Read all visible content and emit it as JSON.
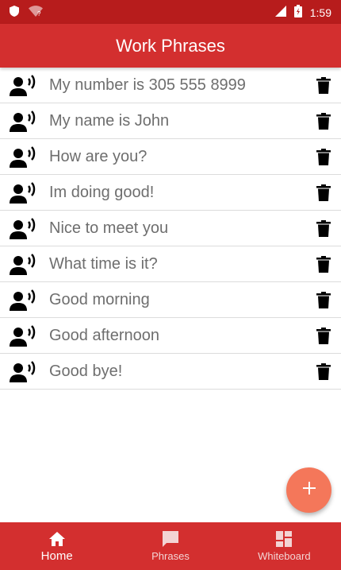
{
  "status_bar": {
    "time": "1:59",
    "icons": [
      "shield-icon",
      "wifi-icon",
      "signal-icon",
      "battery-icon"
    ]
  },
  "app_bar": {
    "title": "Work Phrases"
  },
  "phrases": [
    {
      "text": "My number is 305 555 8999"
    },
    {
      "text": "My name is John"
    },
    {
      "text": "How are you?"
    },
    {
      "text": "Im doing good!"
    },
    {
      "text": "Nice to meet you"
    },
    {
      "text": "What time is it?"
    },
    {
      "text": "Good morning"
    },
    {
      "text": "Good afternoon"
    },
    {
      "text": "Good bye!"
    }
  ],
  "fab": {
    "icon": "plus-icon"
  },
  "bottom_nav": {
    "items": [
      {
        "label": "Home",
        "icon": "home-icon",
        "active": true
      },
      {
        "label": "Phrases",
        "icon": "chat-icon",
        "active": false
      },
      {
        "label": "Whiteboard",
        "icon": "dashboard-icon",
        "active": false
      }
    ]
  },
  "colors": {
    "status_bar": "#b71c1c",
    "primary": "#d32f2f",
    "fab": "#f4775a",
    "phrase_text": "#6e6e6e"
  }
}
